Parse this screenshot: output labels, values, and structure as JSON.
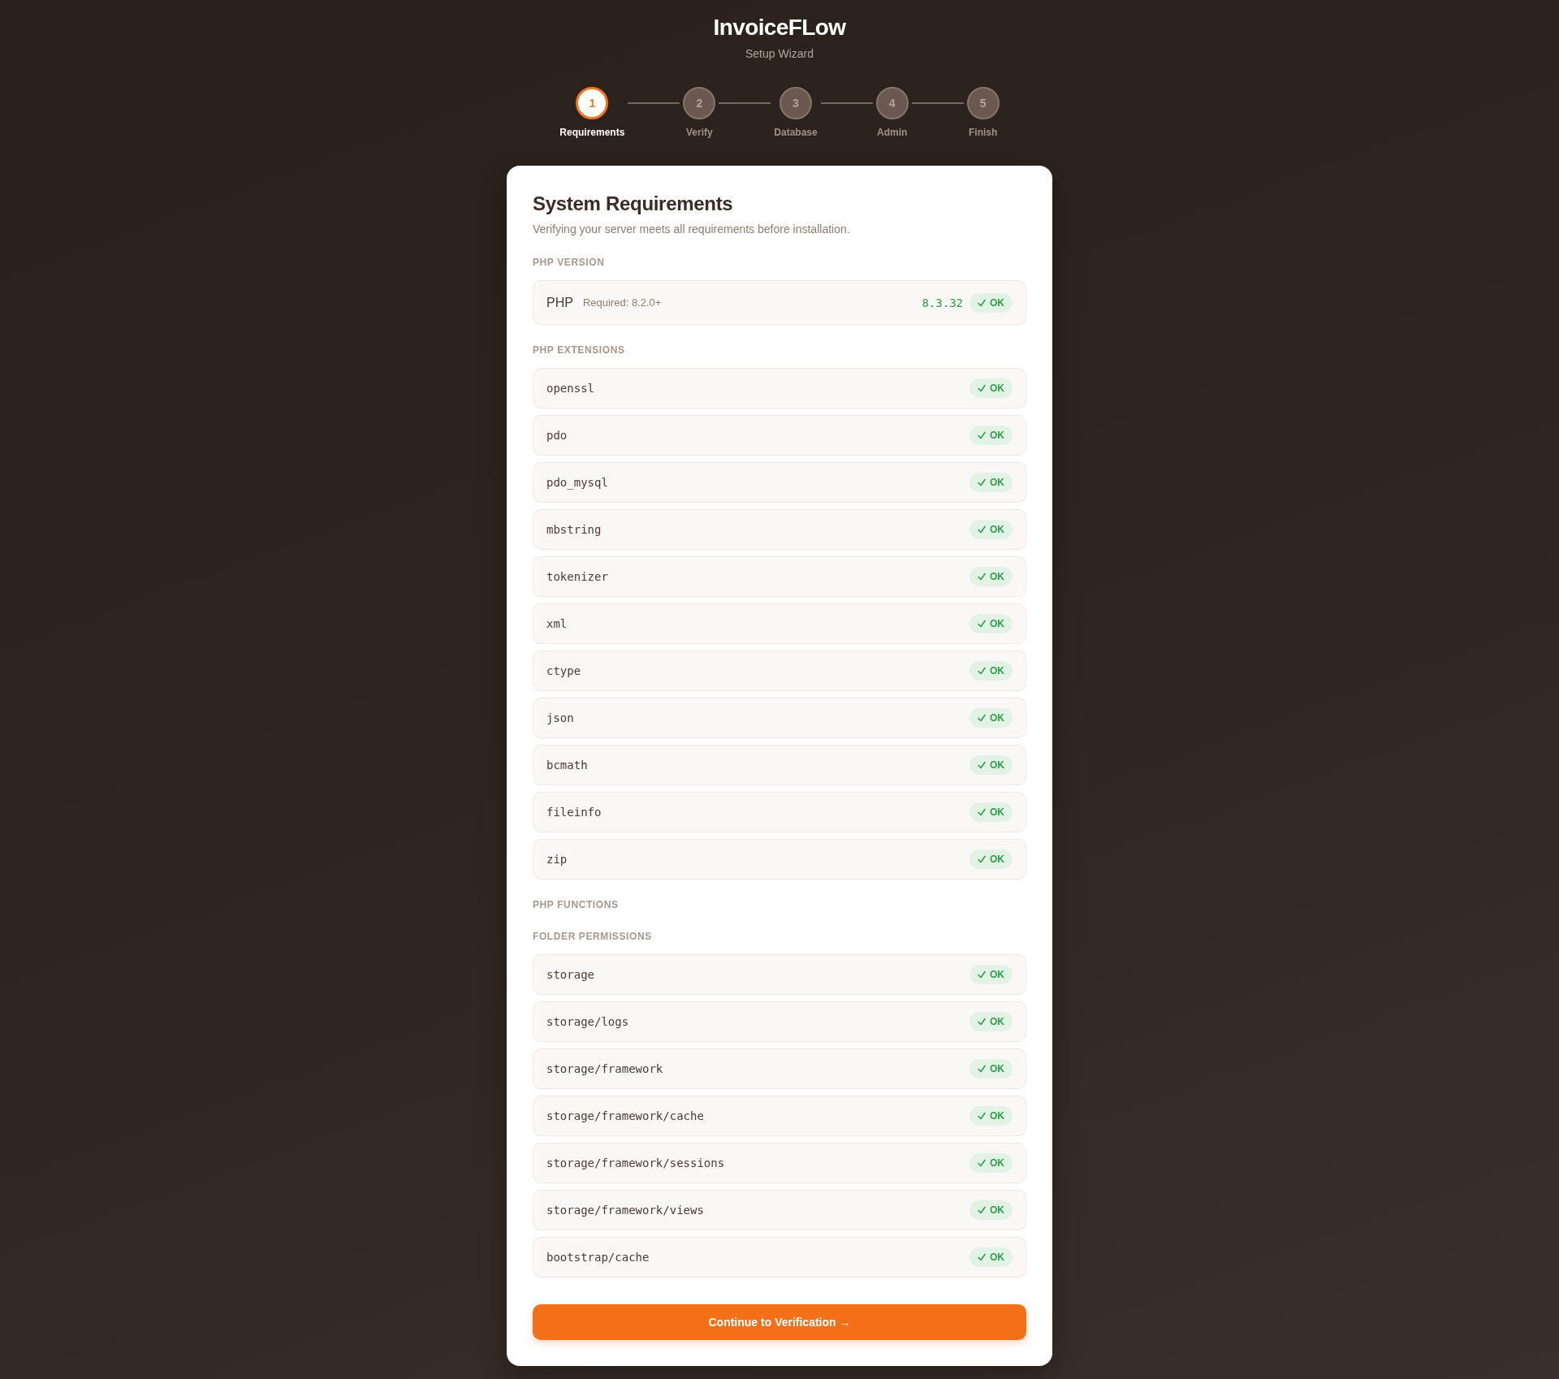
{
  "app": {
    "title": "InvoiceFLow",
    "subtitle": "Setup Wizard"
  },
  "steps": [
    {
      "number": "1",
      "label": "Requirements",
      "selected": true
    },
    {
      "number": "2",
      "label": "Verify",
      "selected": false
    },
    {
      "number": "3",
      "label": "Database",
      "selected": false
    },
    {
      "number": "4",
      "label": "Admin",
      "selected": false
    },
    {
      "number": "5",
      "label": "Finish",
      "selected": false
    }
  ],
  "card": {
    "title": "System Requirements",
    "description": "Verifying your server meets all requirements before installation.",
    "sections": [
      {
        "heading": "PHP VERSION",
        "items": [
          {
            "kind": "version",
            "name": "PHP",
            "requirement": "Required: 8.2.0+",
            "value": "8.3.32",
            "status": "OK",
            "passed": true
          }
        ]
      },
      {
        "heading": "PHP EXTENSIONS",
        "items": [
          {
            "kind": "check",
            "name": "openssl",
            "status": "OK",
            "passed": true
          },
          {
            "kind": "check",
            "name": "pdo",
            "status": "OK",
            "passed": true
          },
          {
            "kind": "check",
            "name": "pdo_mysql",
            "status": "OK",
            "passed": true
          },
          {
            "kind": "check",
            "name": "mbstring",
            "status": "OK",
            "passed": true
          },
          {
            "kind": "check",
            "name": "tokenizer",
            "status": "OK",
            "passed": true
          },
          {
            "kind": "check",
            "name": "xml",
            "status": "OK",
            "passed": true
          },
          {
            "kind": "check",
            "name": "ctype",
            "status": "OK",
            "passed": true
          },
          {
            "kind": "check",
            "name": "json",
            "status": "OK",
            "passed": true
          },
          {
            "kind": "check",
            "name": "bcmath",
            "status": "OK",
            "passed": true
          },
          {
            "kind": "check",
            "name": "fileinfo",
            "status": "OK",
            "passed": true
          },
          {
            "kind": "check",
            "name": "zip",
            "status": "OK",
            "passed": true
          }
        ]
      },
      {
        "heading": "PHP FUNCTIONS"
      },
      {
        "heading": "FOLDER PERMISSIONS",
        "items": [
          {
            "kind": "check",
            "name": "storage",
            "status": "OK",
            "passed": true
          },
          {
            "kind": "check",
            "name": "storage/logs",
            "status": "OK",
            "passed": true
          },
          {
            "kind": "check",
            "name": "storage/framework",
            "status": "OK",
            "passed": true
          },
          {
            "kind": "check",
            "name": "storage/framework/cache",
            "status": "OK",
            "passed": true
          },
          {
            "kind": "check",
            "name": "storage/framework/sessions",
            "status": "OK",
            "passed": true
          },
          {
            "kind": "check",
            "name": "storage/framework/views",
            "status": "OK",
            "passed": true
          },
          {
            "kind": "check",
            "name": "bootstrap/cache",
            "status": "OK",
            "passed": true
          }
        ]
      }
    ],
    "button": {
      "label": "Continue to Verification →"
    }
  }
}
